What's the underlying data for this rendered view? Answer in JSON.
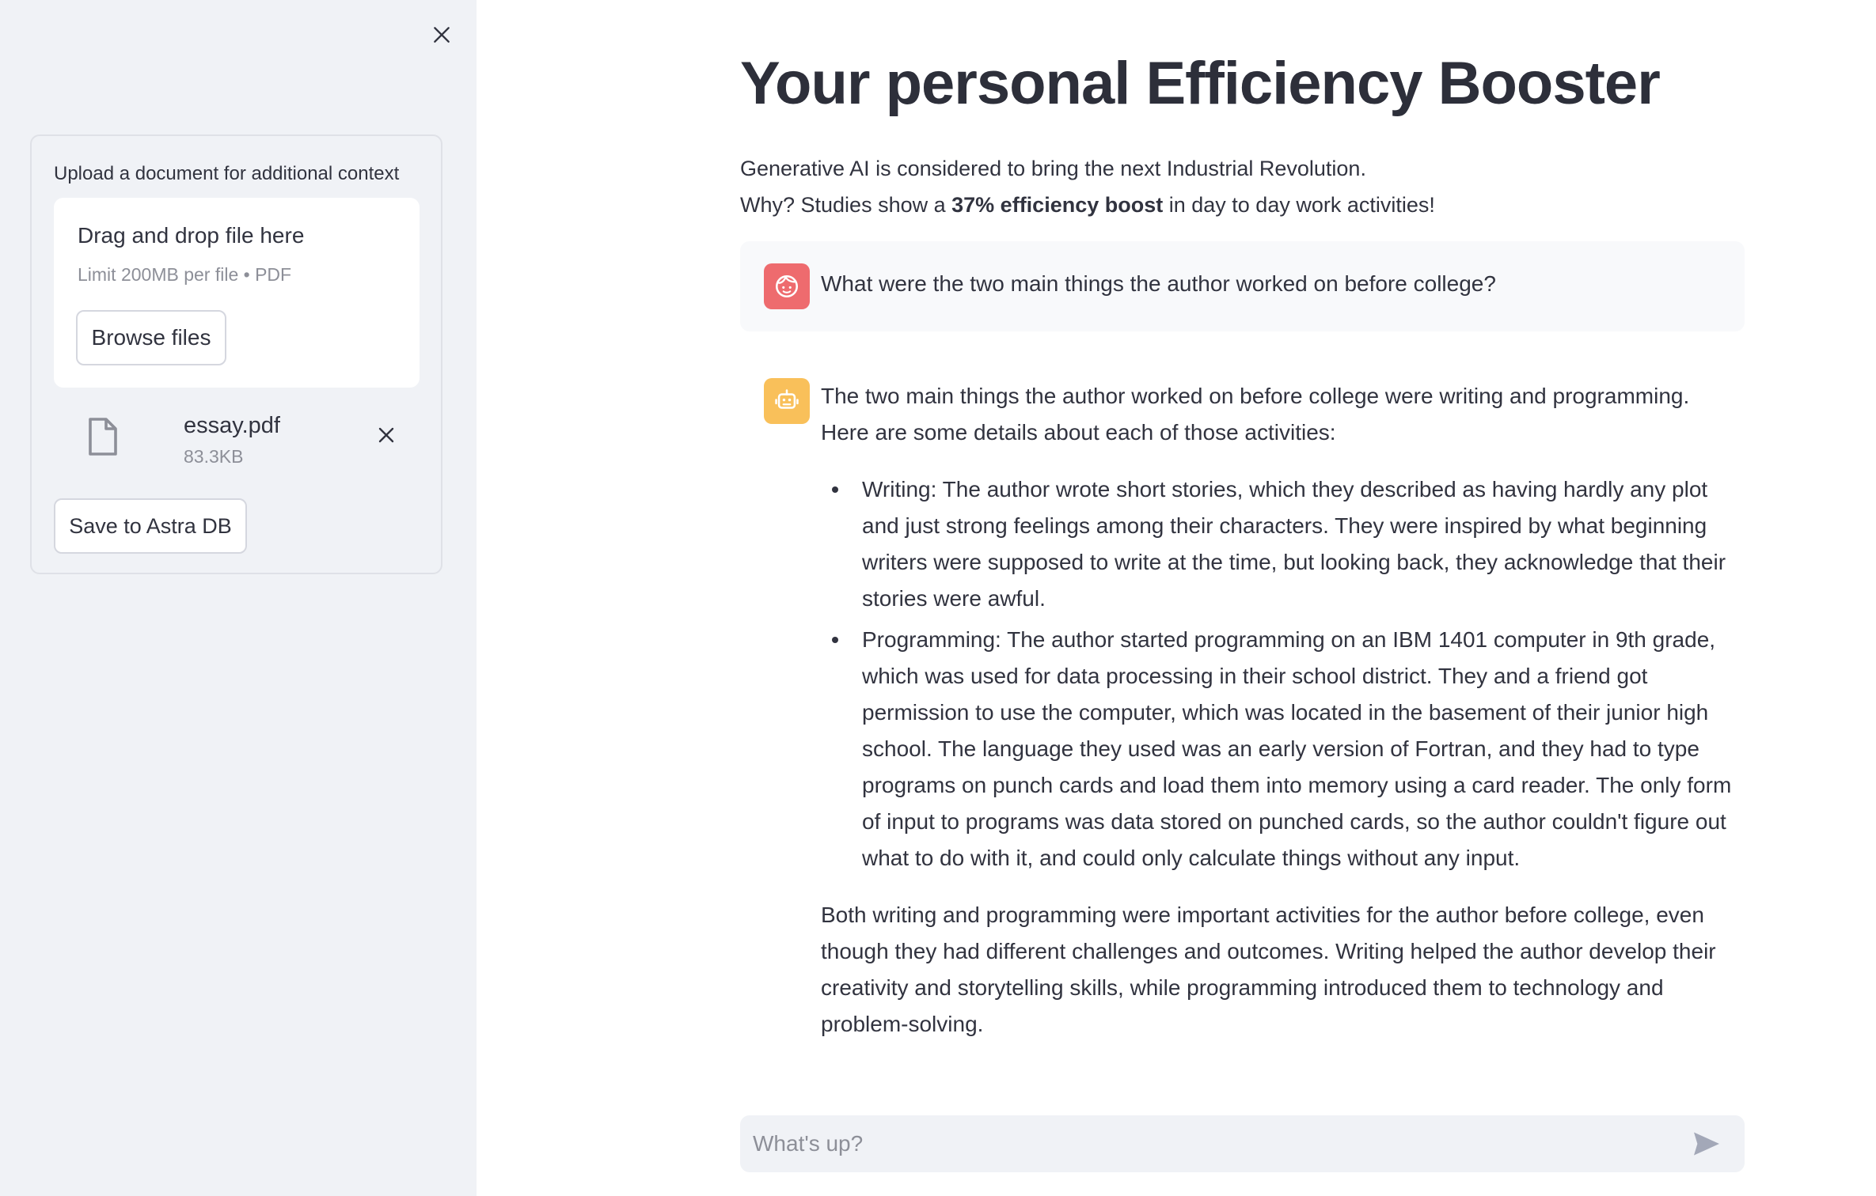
{
  "sidebar": {
    "close_icon": "close-icon",
    "uploader": {
      "label": "Upload a document for additional context",
      "dropzone_title": "Drag and drop file here",
      "dropzone_limit": "Limit 200MB per file • PDF",
      "browse_label": "Browse files"
    },
    "file": {
      "icon": "file-icon",
      "name": "essay.pdf",
      "size": "83.3KB",
      "remove_icon": "close-icon"
    },
    "save_label": "Save to Astra DB"
  },
  "main": {
    "title": "Your personal Efficiency Booster",
    "intro_line1": "Generative AI is considered to bring the next Industrial Revolution.",
    "intro_line2_pre": "Why? Studies show a ",
    "intro_line2_bold": "37% efficiency boost",
    "intro_line2_post": " in day to day work activities!",
    "messages": [
      {
        "role": "user",
        "avatar_color": "#ee6b6e",
        "text": "What were the two main things the author worked on before college?"
      },
      {
        "role": "assistant",
        "avatar_color": "#f9c05a",
        "intro": "The two main things the author worked on before college were writing and programming. Here are some details about each of those activities:",
        "bullets": [
          "Writing: The author wrote short stories, which they described as having hardly any plot and just strong feelings among their characters. They were inspired by what beginning writers were supposed to write at the time, but looking back, they acknowledge that their stories were awful.",
          "Programming: The author started programming on an IBM 1401 computer in 9th grade, which was used for data processing in their school district. They and a friend got permission to use the computer, which was located in the basement of their junior high school. The language they used was an early version of Fortran, and they had to type programs on punch cards and load them into memory using a card reader. The only form of input to programs was data stored on punched cards, so the author couldn't figure out what to do with it, and could only calculate things without any input."
        ],
        "outro": "Both writing and programming were important activities for the author before college, even though they had different challenges and outcomes. Writing helped the author develop their creativity and storytelling skills, while programming introduced them to technology and problem-solving."
      }
    ],
    "chat_input": {
      "placeholder": "What's up?",
      "value": "",
      "send_icon": "send-icon"
    }
  },
  "colors": {
    "sidebar_bg": "#f0f2f6",
    "text": "#31333f",
    "muted": "#8d8f98"
  }
}
